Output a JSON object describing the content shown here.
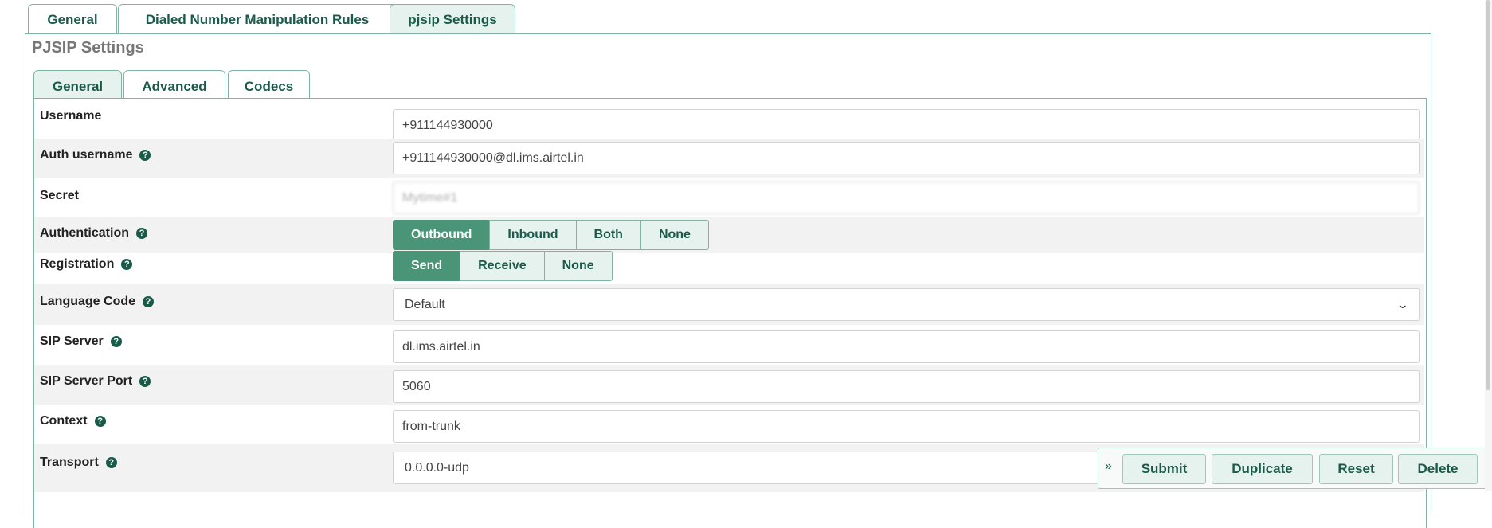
{
  "top_tabs": [
    "General",
    "Dialed Number Manipulation Rules",
    "pjsip Settings"
  ],
  "top_active": "pjsip Settings",
  "panel_title": "PJSIP Settings",
  "sub_tabs": [
    "General",
    "Advanced",
    "Codecs"
  ],
  "sub_active": "General",
  "fields": {
    "username": {
      "label": "Username",
      "value": "+911144930000"
    },
    "auth_username": {
      "label": "Auth username",
      "value": "+911144930000@dl.ims.airtel.in"
    },
    "secret": {
      "label": "Secret",
      "value": "Mytime#1"
    },
    "authentication": {
      "label": "Authentication",
      "options": [
        "Outbound",
        "Inbound",
        "Both",
        "None"
      ],
      "selected": "Outbound"
    },
    "registration": {
      "label": "Registration",
      "options": [
        "Send",
        "Receive",
        "None"
      ],
      "selected": "Send"
    },
    "language_code": {
      "label": "Language Code",
      "value": "Default"
    },
    "sip_server": {
      "label": "SIP Server",
      "value": "dl.ims.airtel.in"
    },
    "sip_server_port": {
      "label": "SIP Server Port",
      "value": "5060"
    },
    "context": {
      "label": "Context",
      "value": "from-trunk"
    },
    "transport": {
      "label": "Transport",
      "value": "0.0.0.0-udp"
    }
  },
  "help_icon_glyph": "?",
  "action_bar": {
    "collapse_glyph": "»",
    "buttons": [
      "Submit",
      "Duplicate",
      "Reset",
      "Delete"
    ]
  },
  "colors": {
    "accent": "#4a9577",
    "tab_text": "#1a5a49",
    "tab_bg": "#e6f2ee",
    "border": "#7fb3a3"
  }
}
